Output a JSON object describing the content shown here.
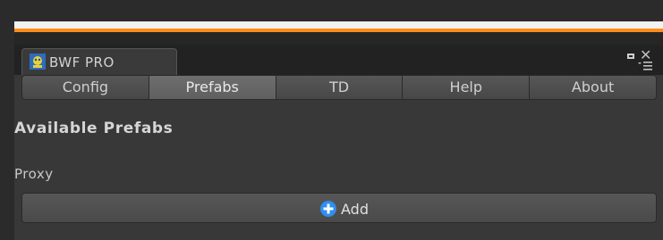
{
  "window": {
    "title": "BWF PRO"
  },
  "toolbar": {
    "tabs": [
      {
        "label": "Config",
        "active": false
      },
      {
        "label": "Prefabs",
        "active": true
      },
      {
        "label": "TD",
        "active": false
      },
      {
        "label": "Help",
        "active": false
      },
      {
        "label": "About",
        "active": false
      }
    ]
  },
  "main": {
    "section_title": "Available Prefabs",
    "proxy_label": "Proxy",
    "add_button_label": "Add"
  },
  "colors": {
    "accent_orange": "#ff8c1a",
    "plus_blue": "#2f8ef0",
    "background": "#383838"
  },
  "icons": {
    "window_tab": "bwf-logo-icon",
    "maximize": "maximize-icon",
    "close": "close-icon",
    "menu": "menu-icon",
    "add": "plus-circle-icon"
  }
}
